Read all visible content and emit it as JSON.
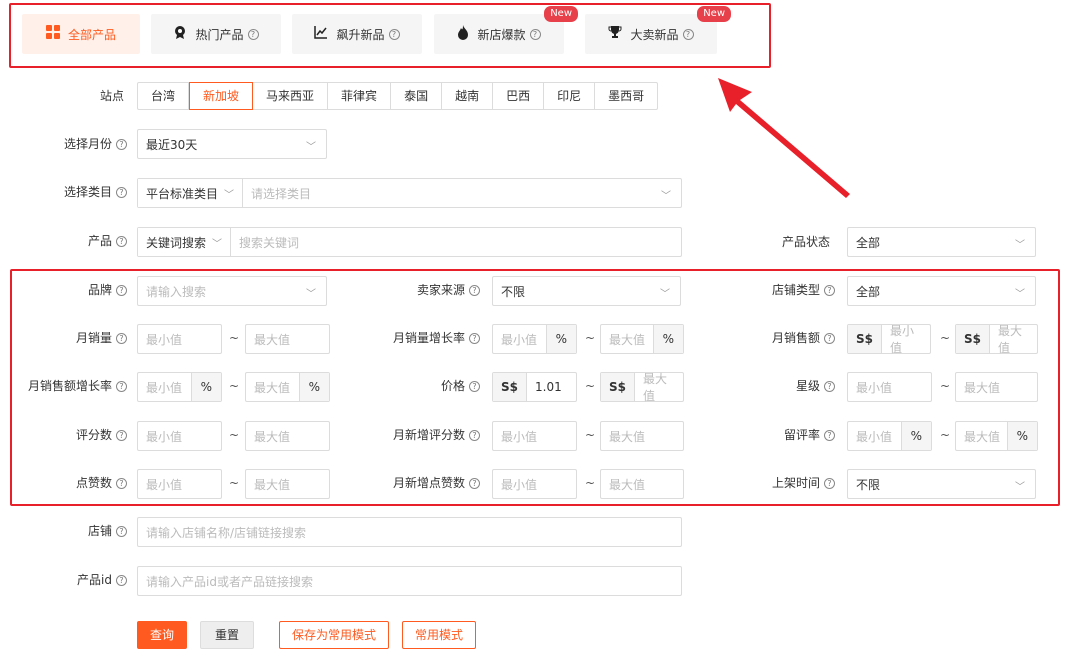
{
  "tabs": [
    {
      "label": "全部产品",
      "help": "",
      "new": ""
    },
    {
      "label": "热门产品",
      "help": "?",
      "new": ""
    },
    {
      "label": "飙升新品",
      "help": "?",
      "new": ""
    },
    {
      "label": "新店爆款",
      "help": "?",
      "new": "New"
    },
    {
      "label": "大卖新品",
      "help": "?",
      "new": "New"
    }
  ],
  "site": {
    "label": "站点",
    "options": [
      "台湾",
      "新加坡",
      "马来西亚",
      "菲律宾",
      "泰国",
      "越南",
      "巴西",
      "印尼",
      "墨西哥"
    ],
    "selected": "新加坡"
  },
  "month": {
    "label": "选择月份",
    "value": "最近30天"
  },
  "category": {
    "label": "选择类目",
    "type": "平台标准类目",
    "placeholder": "请选择类目"
  },
  "product": {
    "label": "产品",
    "type": "关键词搜索",
    "placeholder": "搜索关键词"
  },
  "product_status": {
    "label": "产品状态",
    "value": "全部"
  },
  "brand": {
    "label": "品牌",
    "placeholder": "请输入搜索"
  },
  "seller_source": {
    "label": "卖家来源",
    "value": "不限"
  },
  "shop_type": {
    "label": "店铺类型",
    "value": "全部"
  },
  "min_ph": "最小值",
  "max_ph": "最大值",
  "percent": "%",
  "tilde": "~",
  "currency": "S$",
  "monthly_sales": {
    "label": "月销量"
  },
  "monthly_sales_growth": {
    "label": "月销量增长率"
  },
  "monthly_revenue": {
    "label": "月销售额"
  },
  "monthly_revenue_growth": {
    "label": "月销售额增长率"
  },
  "price": {
    "label": "价格",
    "min_value": "1.01"
  },
  "rating": {
    "label": "星级"
  },
  "review_count": {
    "label": "评分数"
  },
  "monthly_new_reviews": {
    "label": "月新增评分数"
  },
  "review_rate": {
    "label": "留评率"
  },
  "likes": {
    "label": "点赞数"
  },
  "monthly_new_likes": {
    "label": "月新增点赞数"
  },
  "listing_time": {
    "label": "上架时间",
    "value": "不限"
  },
  "shop": {
    "label": "店铺",
    "placeholder": "请输入店铺名称/店铺链接搜索"
  },
  "product_id": {
    "label": "产品id",
    "placeholder": "请输入产品id或者产品链接搜索"
  },
  "buttons": {
    "query": "查询",
    "reset": "重置",
    "save_mode": "保存为常用模式",
    "common_mode": "常用模式"
  },
  "colors": {
    "accent": "#ff5a1f",
    "highlight": "#e8202a",
    "badge": "#e8404a"
  }
}
